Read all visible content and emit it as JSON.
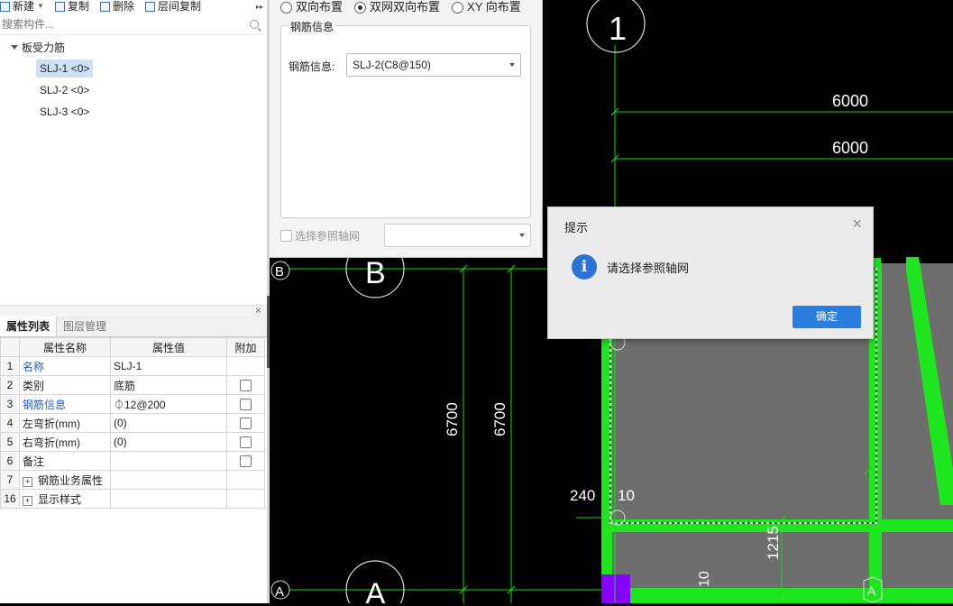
{
  "toolbar": {
    "new_label": "新建",
    "copy_label": "复制",
    "delete_label": "删除",
    "floor_copy_label": "层间复制",
    "more_glyph": "▸▸"
  },
  "search": {
    "placeholder": "搜索构件..."
  },
  "tree": {
    "root_label": "板受力筋",
    "items": [
      {
        "label": "SLJ-1 <0>",
        "selected": true
      },
      {
        "label": "SLJ-2 <0>",
        "selected": false
      },
      {
        "label": "SLJ-3 <0>",
        "selected": false
      }
    ]
  },
  "props": {
    "close_glyph": "×",
    "tabs": [
      "属性列表",
      "图层管理"
    ],
    "headers": [
      "属性名称",
      "属性值",
      "附加"
    ],
    "rows": [
      {
        "num": "1",
        "name": "名称",
        "value": "SLJ-1"
      },
      {
        "num": "2",
        "name": "类别",
        "value": "底筋"
      },
      {
        "num": "3",
        "name": "钢筋信息",
        "value": "⏀12@200"
      },
      {
        "num": "4",
        "name": "左弯折(mm)",
        "value": "(0)"
      },
      {
        "num": "5",
        "name": "右弯折(mm)",
        "value": "(0)"
      },
      {
        "num": "6",
        "name": "备注",
        "value": ""
      },
      {
        "num": "7",
        "name": "钢筋业务属性",
        "value": ""
      },
      {
        "num": "16",
        "name": "显示样式",
        "value": ""
      }
    ]
  },
  "rebar_dialog": {
    "radio_options": [
      "双向布置",
      "双网双向布置",
      "XY 向布置"
    ],
    "selected_radio": "双网双向布置",
    "group_title": "钢筋信息",
    "field_label": "钢筋信息:",
    "field_value": "SLJ-2(C8@150)",
    "axis_checkbox_label": "选择参照轴网"
  },
  "cad": {
    "dims": [
      "6000",
      "6000",
      "6700",
      "6700",
      "240",
      "10",
      "1215",
      "10"
    ],
    "axis_labels": [
      "1",
      "B",
      "A",
      "B",
      "A",
      "A"
    ],
    "colors": {
      "background": "#000000",
      "dim_line": "#19d419",
      "slab_fill": "#6e6e6e",
      "beam": "#1ee61e",
      "column": "#8800ff"
    }
  },
  "popup": {
    "title": "提示",
    "close_glyph": "×",
    "info_glyph": "i",
    "message": "请选择参照轴网",
    "ok_label": "确定"
  }
}
